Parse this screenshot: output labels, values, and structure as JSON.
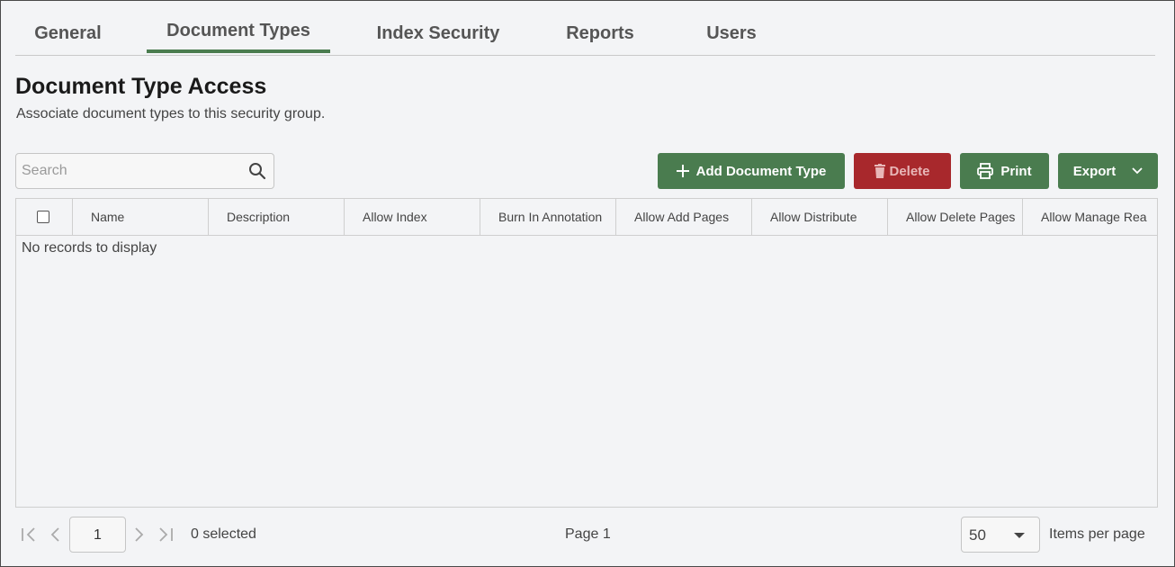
{
  "tabs": [
    {
      "label": "General"
    },
    {
      "label": "Document Types",
      "active": true
    },
    {
      "label": "Index Security"
    },
    {
      "label": "Reports"
    },
    {
      "label": "Users"
    }
  ],
  "header": {
    "title": "Document Type Access",
    "subtitle": "Associate document types to this security group."
  },
  "search": {
    "placeholder": "Search",
    "value": ""
  },
  "toolbar": {
    "add_label": "Add Document Type",
    "delete_label": "Delete",
    "print_label": "Print",
    "export_label": "Export"
  },
  "grid": {
    "columns": [
      "Name",
      "Description",
      "Allow Index",
      "Burn In Annotation",
      "Allow Add Pages",
      "Allow Distribute",
      "Allow Delete Pages",
      "Allow Manage Rea"
    ],
    "empty_message": "No records to display"
  },
  "pager": {
    "current_page": "1",
    "selected_text": "0 selected",
    "page_text": "Page 1",
    "items_per_page": "50",
    "items_per_page_label": "Items per page"
  },
  "colors": {
    "accent": "#4a7c4f",
    "danger": "#a8282c"
  }
}
